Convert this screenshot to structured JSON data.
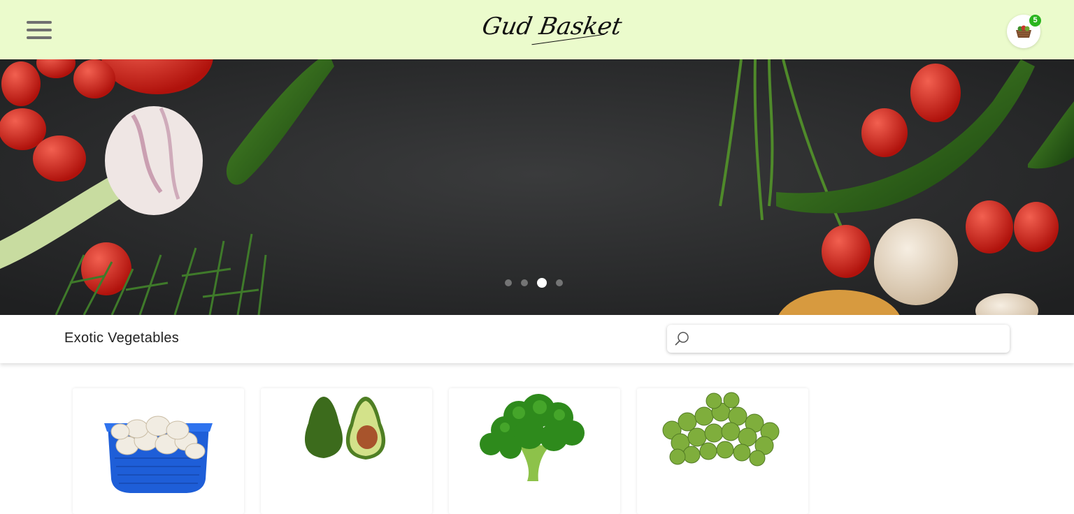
{
  "header": {
    "menu_icon": "hamburger-menu-icon",
    "brand": "Gud Basket",
    "cart_icon": "vegetable-basket-icon",
    "cart_count": "5",
    "background_color": "#ebfbcc",
    "badge_color": "#2bb51f"
  },
  "hero": {
    "slides": 4,
    "active_slide": 3
  },
  "category": {
    "title": "Exotic Vegetables"
  },
  "search": {
    "placeholder": "",
    "value": "",
    "icon": "search-icon"
  },
  "products": [
    {
      "image": "mushrooms-in-blue-tray"
    },
    {
      "image": "avocado"
    },
    {
      "image": "broccoli"
    },
    {
      "image": "brussels-sprouts"
    }
  ]
}
